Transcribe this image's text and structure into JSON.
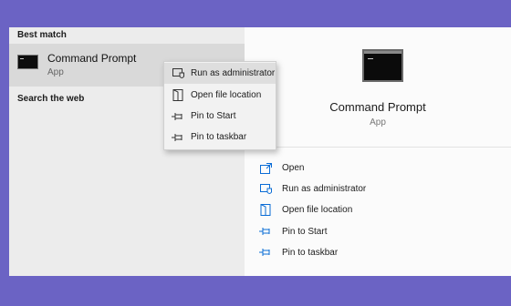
{
  "search": {
    "best_match_label": "Best match",
    "search_web_label": "Search the web",
    "result": {
      "title": "Command Prompt",
      "subtitle": "App",
      "icon": "cmd-icon"
    }
  },
  "context_menu": {
    "items": [
      {
        "label": "Run as administrator",
        "icon": "shield-icon",
        "highlighted": true
      },
      {
        "label": "Open file location",
        "icon": "folder-icon"
      },
      {
        "label": "Pin to Start",
        "icon": "pin-icon"
      },
      {
        "label": "Pin to taskbar",
        "icon": "pin-icon"
      }
    ]
  },
  "preview": {
    "title": "Command Prompt",
    "subtitle": "App",
    "actions": [
      {
        "label": "Open",
        "icon": "open-icon"
      },
      {
        "label": "Run as administrator",
        "icon": "shield-icon"
      },
      {
        "label": "Open file location",
        "icon": "folder-icon"
      },
      {
        "label": "Pin to Start",
        "icon": "pin-icon"
      },
      {
        "label": "Pin to taskbar",
        "icon": "pin-icon"
      }
    ]
  },
  "colors": {
    "background": "#6b63c4",
    "accent_icon": "#0a6cd6",
    "highlight": "#d9d9d9"
  }
}
